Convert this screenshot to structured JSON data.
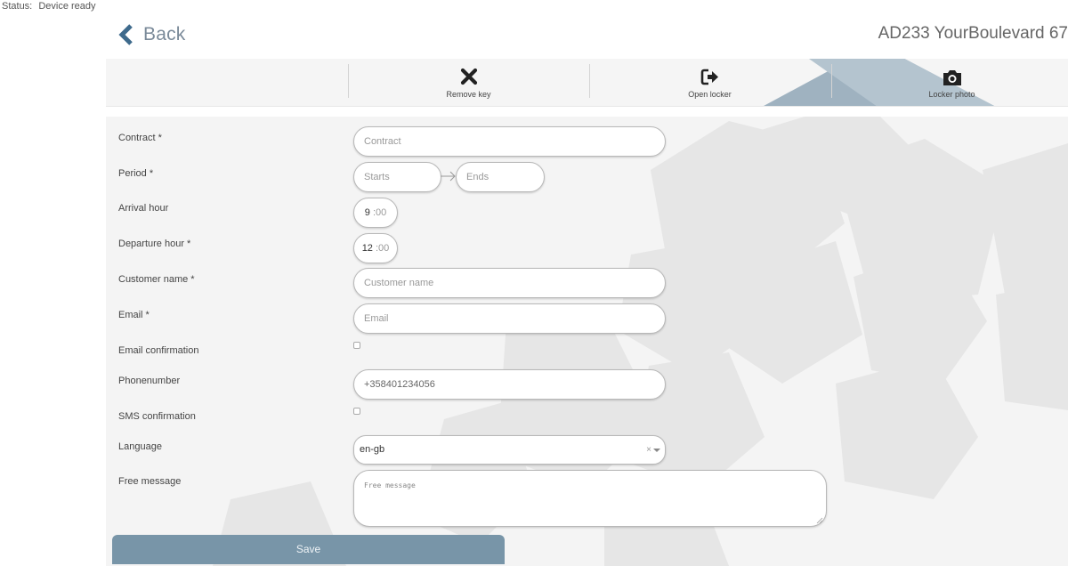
{
  "status": {
    "label": "Status:",
    "value": "Device ready"
  },
  "header": {
    "back_label": "Back",
    "title": "AD233 YourBoulevard 67"
  },
  "toolbar": {
    "items": [
      {
        "label": "Remove key",
        "icon": "close-icon"
      },
      {
        "label": "Open locker",
        "icon": "sign-out-icon"
      },
      {
        "label": "Locker photo",
        "icon": "camera-icon"
      }
    ]
  },
  "form": {
    "contract": {
      "label": "Contract *",
      "placeholder": "Contract"
    },
    "period": {
      "label": "Period *",
      "starts_placeholder": "Starts",
      "ends_placeholder": "Ends"
    },
    "arrival": {
      "label": "Arrival hour",
      "hour": "9",
      "minutes": ":00"
    },
    "departure": {
      "label": "Departure hour *",
      "hour": "12",
      "minutes": ":00"
    },
    "customer_name": {
      "label": "Customer name *",
      "placeholder": "Customer name"
    },
    "email": {
      "label": "Email *",
      "placeholder": "Email"
    },
    "email_confirmation": {
      "label": "Email confirmation",
      "checked": false
    },
    "phone": {
      "label": "Phonenumber",
      "value": "+358401234056"
    },
    "sms_confirmation": {
      "label": "SMS confirmation",
      "checked": false
    },
    "language": {
      "label": "Language",
      "value": "en-gb",
      "clear": "×"
    },
    "free_message": {
      "label": "Free message",
      "placeholder": "Free message"
    },
    "save_label": "Save"
  },
  "colors": {
    "accent": "#7895a8",
    "back": "#7a8a99",
    "background_shapes": "#e7e7e7"
  }
}
